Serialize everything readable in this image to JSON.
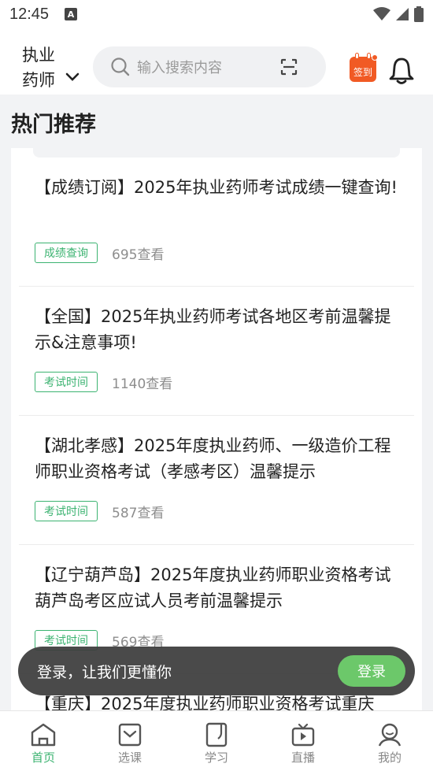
{
  "status_bar": {
    "time": "12:45",
    "notification_letter": "A"
  },
  "header": {
    "exam_line1": "执业",
    "exam_line2": "药师",
    "search_placeholder": "输入搜索内容",
    "checkin_label": "签到",
    "accent_color": "#3cb371",
    "checkin_color": "#f15a24"
  },
  "section": {
    "title": "热门推荐"
  },
  "articles": [
    {
      "title": "【成绩订阅】2025年执业药师考试成绩一键查询!",
      "tag": "成绩查询",
      "views": "695查看"
    },
    {
      "title": "【全国】2025年执业药师考试各地区考前温馨提示&注意事项!",
      "tag": "考试时间",
      "views": "1140查看"
    },
    {
      "title": "【湖北孝感】2025年度执业药师、一级造价工程师职业资格考试（孝感考区）温馨提示",
      "tag": "考试时间",
      "views": "587查看"
    },
    {
      "title": "【辽宁葫芦岛】2025年度执业药师职业资格考试葫芦岛考区应试人员考前温馨提示",
      "tag": "考试时间",
      "views": "569查看"
    },
    {
      "title": "【重庆】2025年度执业药师职业资格考试重庆",
      "tag": "",
      "views": ""
    }
  ],
  "login_toast": {
    "text": "登录，让我们更懂你",
    "button": "登录"
  },
  "bottom_nav": [
    {
      "label": "首页",
      "icon": "home-icon",
      "active": true
    },
    {
      "label": "选课",
      "icon": "course-icon",
      "active": false
    },
    {
      "label": "学习",
      "icon": "study-icon",
      "active": false
    },
    {
      "label": "直播",
      "icon": "live-icon",
      "active": false
    },
    {
      "label": "我的",
      "icon": "profile-icon",
      "active": false
    }
  ]
}
